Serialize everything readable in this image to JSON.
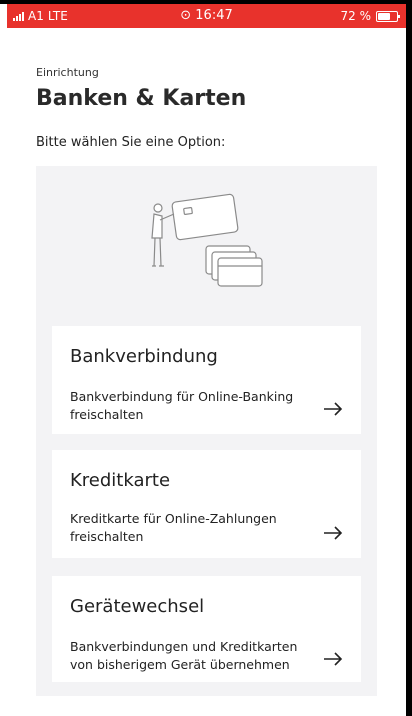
{
  "statusbar": {
    "carrier": "A1",
    "network": "LTE",
    "time": "16:47",
    "battery": "72 %",
    "battery_level": 0.72,
    "background_color": "#e8322c"
  },
  "header": {
    "eyebrow": "Einrichtung",
    "title": "Banken & Karten",
    "subtitle": "Bitte wählen Sie eine Option:"
  },
  "options": [
    {
      "title": "Bankverbindung",
      "line1": "Bankverbindung für Online-Banking",
      "line2": "freischalten",
      "icon": "arrow-right-icon"
    },
    {
      "title": "Kreditkarte",
      "line1": "Kreditkarte für Online-Zahlungen",
      "line2": "freischalten",
      "icon": "arrow-right-icon"
    },
    {
      "title": "Gerätewechsel",
      "line1": "Bankverbindungen und Kreditkarten",
      "line2": "von bisherigem Gerät übernehmen",
      "icon": "arrow-right-icon"
    }
  ],
  "illustration": {
    "icon": "person-holding-cards-illustration"
  }
}
